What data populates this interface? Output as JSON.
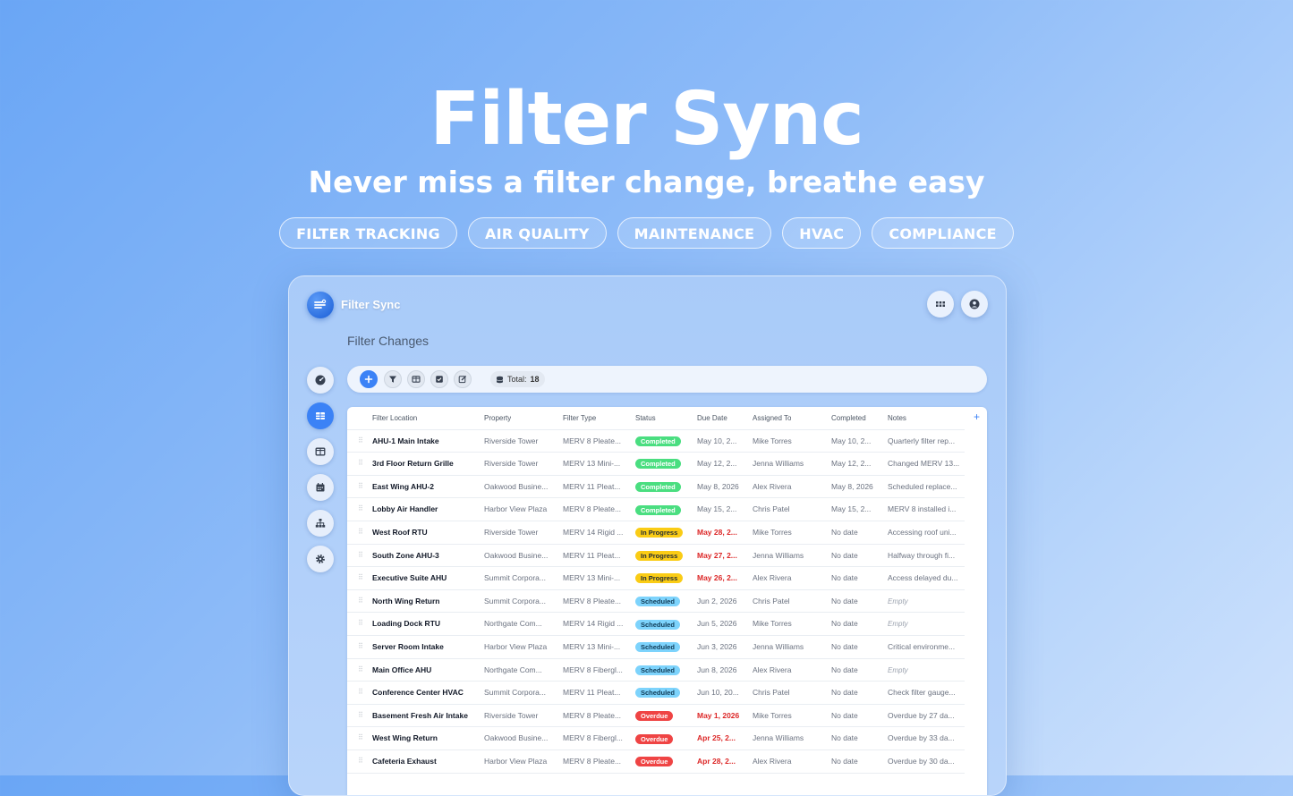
{
  "hero": {
    "title": "Filter Sync",
    "subtitle": "Never miss a filter change, breathe easy",
    "tags": [
      "FILTER TRACKING",
      "AIR QUALITY",
      "MAINTENANCE",
      "HVAC",
      "COMPLIANCE"
    ]
  },
  "app": {
    "name": "Filter Sync",
    "page_title": "Filter Changes",
    "toolbar": {
      "total_label": "Total:",
      "total_value": "18"
    },
    "sidebar": [
      "dashboard-icon",
      "table-icon",
      "board-icon",
      "calendar-icon",
      "hierarchy-icon",
      "settings-icon"
    ],
    "colors": {
      "accent": "#3b82f6",
      "completed": "#4ade80",
      "in_progress": "#facc15",
      "scheduled": "#7dd3fc",
      "overdue": "#ef4444"
    },
    "table": {
      "columns": [
        "Filter Location",
        "Property",
        "Filter Type",
        "Status",
        "Due Date",
        "Assigned To",
        "Completed",
        "Notes"
      ],
      "rows": [
        {
          "location": "AHU-1 Main Intake",
          "property": "Riverside Tower",
          "type": "MERV 8 Pleate...",
          "status": "Completed",
          "due": "May 10, 2...",
          "assigned": "Mike Torres",
          "completed": "May 10, 2...",
          "notes": "Quarterly filter rep..."
        },
        {
          "location": "3rd Floor Return Grille",
          "property": "Riverside Tower",
          "type": "MERV 13 Mini-...",
          "status": "Completed",
          "due": "May 12, 2...",
          "assigned": "Jenna Williams",
          "completed": "May 12, 2...",
          "notes": "Changed MERV 13..."
        },
        {
          "location": "East Wing AHU-2",
          "property": "Oakwood Busine...",
          "type": "MERV 11 Pleat...",
          "status": "Completed",
          "due": "May 8, 2026",
          "assigned": "Alex Rivera",
          "completed": "May 8, 2026",
          "notes": "Scheduled replace..."
        },
        {
          "location": "Lobby Air Handler",
          "property": "Harbor View Plaza",
          "type": "MERV 8 Pleate...",
          "status": "Completed",
          "due": "May 15, 2...",
          "assigned": "Chris Patel",
          "completed": "May 15, 2...",
          "notes": "MERV 8 installed i..."
        },
        {
          "location": "West Roof RTU",
          "property": "Riverside Tower",
          "type": "MERV 14 Rigid ...",
          "status": "In Progress",
          "due": "May 28, 2...",
          "assigned": "Mike Torres",
          "completed": "No date",
          "notes": "Accessing roof uni..."
        },
        {
          "location": "South Zone AHU-3",
          "property": "Oakwood Busine...",
          "type": "MERV 11 Pleat...",
          "status": "In Progress",
          "due": "May 27, 2...",
          "assigned": "Jenna Williams",
          "completed": "No date",
          "notes": "Halfway through fi..."
        },
        {
          "location": "Executive Suite AHU",
          "property": "Summit Corpora...",
          "type": "MERV 13 Mini-...",
          "status": "In Progress",
          "due": "May 26, 2...",
          "assigned": "Alex Rivera",
          "completed": "No date",
          "notes": "Access delayed du..."
        },
        {
          "location": "North Wing Return",
          "property": "Summit Corpora...",
          "type": "MERV 8 Pleate...",
          "status": "Scheduled",
          "due": "Jun 2, 2026",
          "assigned": "Chris Patel",
          "completed": "No date",
          "notes": "Empty"
        },
        {
          "location": "Loading Dock RTU",
          "property": "Northgate Com...",
          "type": "MERV 14 Rigid ...",
          "status": "Scheduled",
          "due": "Jun 5, 2026",
          "assigned": "Mike Torres",
          "completed": "No date",
          "notes": "Empty"
        },
        {
          "location": "Server Room Intake",
          "property": "Harbor View Plaza",
          "type": "MERV 13 Mini-...",
          "status": "Scheduled",
          "due": "Jun 3, 2026",
          "assigned": "Jenna Williams",
          "completed": "No date",
          "notes": "Critical environme..."
        },
        {
          "location": "Main Office AHU",
          "property": "Northgate Com...",
          "type": "MERV 8 Fibergl...",
          "status": "Scheduled",
          "due": "Jun 8, 2026",
          "assigned": "Alex Rivera",
          "completed": "No date",
          "notes": "Empty"
        },
        {
          "location": "Conference Center HVAC",
          "property": "Summit Corpora...",
          "type": "MERV 11 Pleat...",
          "status": "Scheduled",
          "due": "Jun 10, 20...",
          "assigned": "Chris Patel",
          "completed": "No date",
          "notes": "Check filter gauge..."
        },
        {
          "location": "Basement Fresh Air Intake",
          "property": "Riverside Tower",
          "type": "MERV 8 Pleate...",
          "status": "Overdue",
          "due": "May 1, 2026",
          "assigned": "Mike Torres",
          "completed": "No date",
          "notes": "Overdue by 27 da..."
        },
        {
          "location": "West Wing Return",
          "property": "Oakwood Busine...",
          "type": "MERV 8 Fibergl...",
          "status": "Overdue",
          "due": "Apr 25, 2...",
          "assigned": "Jenna Williams",
          "completed": "No date",
          "notes": "Overdue by 33 da..."
        },
        {
          "location": "Cafeteria Exhaust",
          "property": "Harbor View Plaza",
          "type": "MERV 8 Pleate...",
          "status": "Overdue",
          "due": "Apr 28, 2...",
          "assigned": "Alex Rivera",
          "completed": "No date",
          "notes": "Overdue by 30 da..."
        }
      ]
    }
  }
}
